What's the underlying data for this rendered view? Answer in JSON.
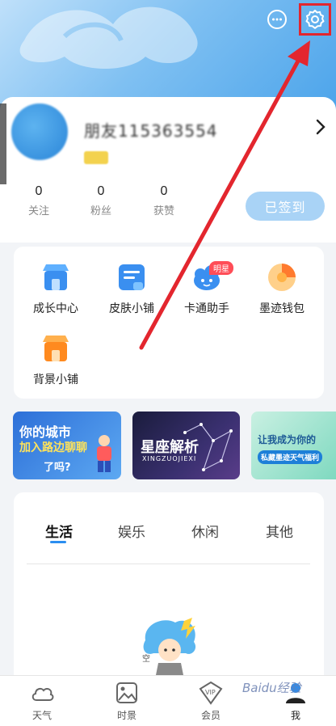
{
  "header": {
    "chat_icon": "chat-bubble-icon",
    "settings_icon": "gear-icon"
  },
  "profile": {
    "username": "朋友115363554",
    "stats": [
      {
        "value": "0",
        "label": "关注"
      },
      {
        "value": "0",
        "label": "粉丝"
      },
      {
        "value": "0",
        "label": "获赞"
      }
    ],
    "checkin_label": "已签到"
  },
  "services": [
    {
      "label": "成长中心",
      "icon": "shop-icon"
    },
    {
      "label": "皮肤小铺",
      "icon": "skin-icon"
    },
    {
      "label": "卡通助手",
      "icon": "cartoon-icon",
      "badge": "明星"
    },
    {
      "label": "墨迹钱包",
      "icon": "wallet-icon"
    },
    {
      "label": "背景小铺",
      "icon": "shop-icon"
    }
  ],
  "banners": {
    "city": {
      "line1": "你的城市",
      "line2": "加入路边聊聊",
      "line3": "了吗?"
    },
    "zodiac": {
      "title": "星座解析",
      "sub": "XINGZUOJIEXI"
    },
    "become": {
      "title": "让我成为你的",
      "sub": "私藏墨迹天气福利"
    }
  },
  "tabs": [
    "生活",
    "娱乐",
    "休闲",
    "其他"
  ],
  "bottom_nav": [
    {
      "label": "天气",
      "icon": "cloud-icon"
    },
    {
      "label": "时景",
      "icon": "image-icon"
    },
    {
      "label": "会员",
      "icon": "vip-icon"
    },
    {
      "label": "我",
      "icon": "person-icon"
    }
  ],
  "watermark": "Baidu经验",
  "colors": {
    "accent": "#2b8ef0",
    "highlight": "#e3262e",
    "checkin_bg": "#a9d3f6"
  }
}
